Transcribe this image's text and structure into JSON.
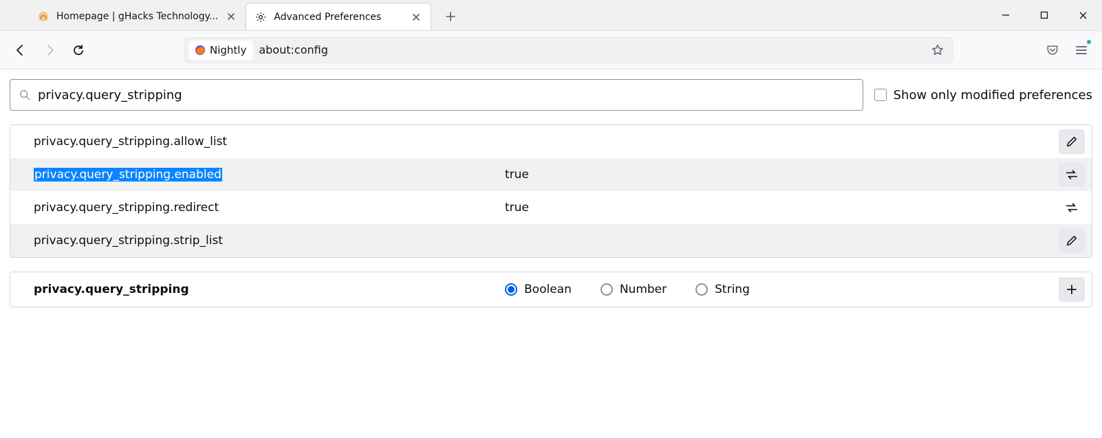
{
  "tabs": [
    {
      "label": "Homepage | gHacks Technology..."
    },
    {
      "label": "Advanced Preferences"
    }
  ],
  "identity": {
    "label": "Nightly"
  },
  "url": "about:config",
  "search": {
    "value": "privacy.query_stripping",
    "show_modified_label": "Show only modified preferences"
  },
  "prefs": [
    {
      "name": "privacy.query_stripping.allow_list",
      "value": "",
      "action": "edit",
      "alt": false,
      "selected": false
    },
    {
      "name": "privacy.query_stripping.enabled",
      "value": "true",
      "action": "toggle",
      "alt": true,
      "selected": true
    },
    {
      "name": "privacy.query_stripping.redirect",
      "value": "true",
      "action": "toggle",
      "alt": false,
      "selected": false
    },
    {
      "name": "privacy.query_stripping.strip_list",
      "value": "",
      "action": "edit",
      "alt": true,
      "selected": false
    }
  ],
  "add_row": {
    "name": "privacy.query_stripping",
    "types": [
      {
        "label": "Boolean",
        "checked": true
      },
      {
        "label": "Number",
        "checked": false
      },
      {
        "label": "String",
        "checked": false
      }
    ]
  }
}
